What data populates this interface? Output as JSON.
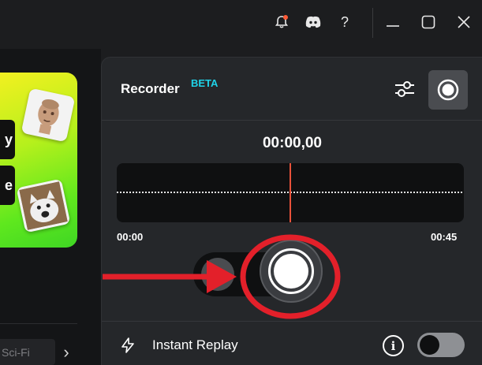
{
  "titlebar": {
    "icons": [
      "bell-icon",
      "discord-icon",
      "help-icon",
      "minimize-icon",
      "maximize-icon",
      "close-icon"
    ],
    "help_glyph": "?",
    "notification_color": "#ff5a36"
  },
  "left_panel": {
    "promo_tag_1": "y",
    "promo_tag_2": "e",
    "category_chip": "Sci-Fi",
    "next_glyph": "›"
  },
  "recorder": {
    "title": "Recorder",
    "badge": "BETA",
    "timer": "00:00,00",
    "time_start": "00:00",
    "time_end": "00:45",
    "playhead_position": 0.5,
    "instant_replay_label": "Instant Replay",
    "instant_replay_enabled": false,
    "info_glyph": "i"
  },
  "colors": {
    "accent_beta": "#1fd3e8",
    "playhead": "#e8523a",
    "annotation_red": "#e3202a"
  }
}
